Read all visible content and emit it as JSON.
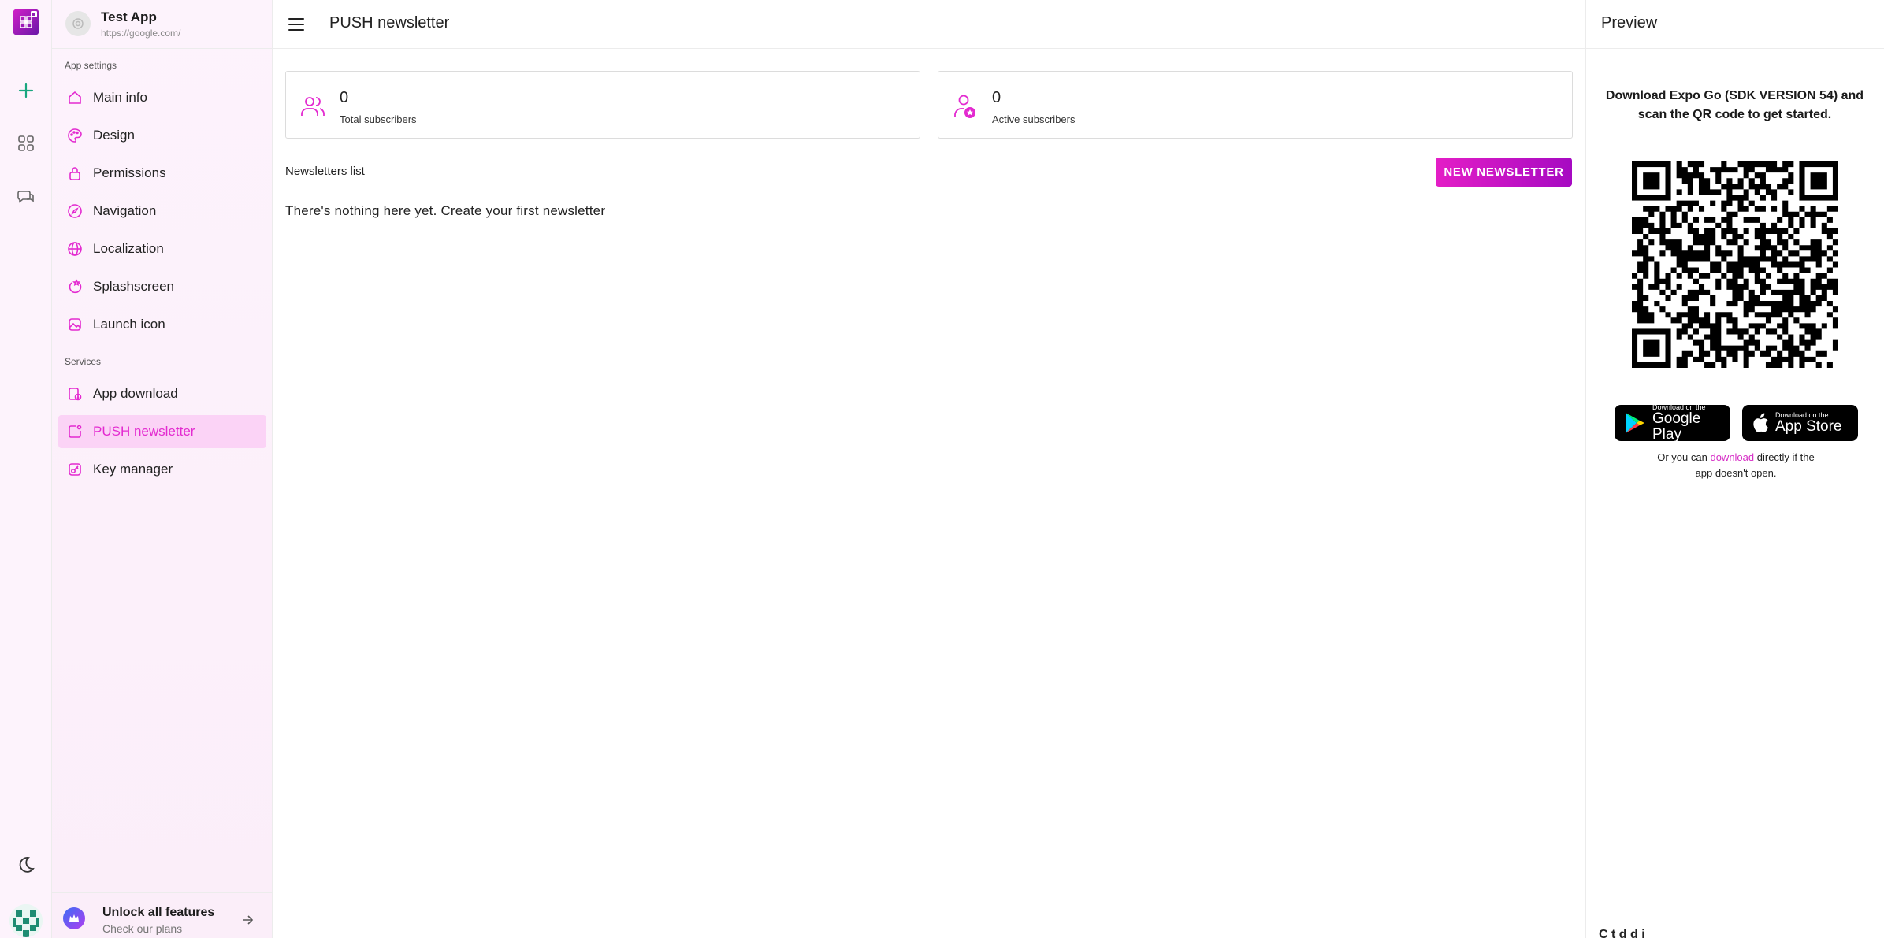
{
  "rail": {
    "icons": [
      "app-logo-icon",
      "plus-icon",
      "apps-grid-icon",
      "chat-icon",
      "moon-icon"
    ],
    "accent": "#19a67f"
  },
  "sidebar": {
    "app_name": "Test App",
    "app_url": "https://google.com/",
    "app_settings_title": "App settings",
    "services_title": "Services",
    "settings_items": [
      {
        "label": "Main info",
        "icon": "home-icon"
      },
      {
        "label": "Design",
        "icon": "palette-icon"
      },
      {
        "label": "Permissions",
        "icon": "lock-icon"
      },
      {
        "label": "Navigation",
        "icon": "compass-icon"
      },
      {
        "label": "Localization",
        "icon": "globe-icon"
      },
      {
        "label": "Splashscreen",
        "icon": "splash-icon"
      },
      {
        "label": "Launch icon",
        "icon": "image-icon"
      }
    ],
    "services_items": [
      {
        "label": "App download",
        "icon": "download-icon"
      },
      {
        "label": "PUSH newsletter",
        "icon": "push-icon",
        "active": true
      },
      {
        "label": "Key manager",
        "icon": "key-icon"
      }
    ],
    "upgrade_title": "Unlock all features",
    "upgrade_sub": "Check our plans"
  },
  "header": {
    "title": "PUSH newsletter"
  },
  "stats": [
    {
      "value": "0",
      "label": "Total subscribers",
      "icon": "users-icon"
    },
    {
      "value": "0",
      "label": "Active subscribers",
      "icon": "user-star-icon"
    }
  ],
  "newsletters": {
    "title": "Newsletters list",
    "button_label": "NEW NEWSLETTER",
    "empty_text": "There's nothing here yet. Create your first newsletter"
  },
  "preview": {
    "title": "Preview",
    "description": "Download Expo Go (SDK VERSION 54) and scan the QR code to get started.",
    "google_play_small": "Download on the",
    "google_play_big": "Google Play",
    "app_store_small": "Download on the",
    "app_store_big": "App Store",
    "alt_prefix": "Or you can",
    "alt_link": "download",
    "alt_suffix": "directly if the app doesn't open.",
    "bottom_partial": "C          t  d d   i"
  },
  "colors": {
    "accent": "#e32ad0",
    "accent_bg": "#fbd3f6",
    "button_start": "#e41ec6",
    "button_end": "#a60ac2"
  }
}
